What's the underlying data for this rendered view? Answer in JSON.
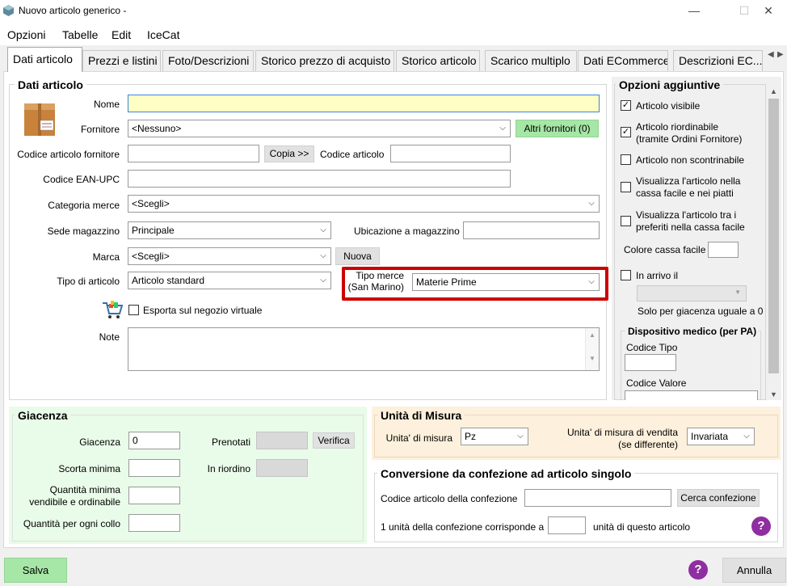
{
  "window": {
    "title": "Nuovo articolo generico -",
    "minimize": "—",
    "maximize": "☐",
    "close": "✕"
  },
  "menu": [
    "Opzioni",
    "Tabelle",
    "Edit",
    "IceCat"
  ],
  "tabs": [
    "Dati articolo",
    "Prezzi e listini",
    "Foto/Descrizioni",
    "Storico prezzo di acquisto",
    "Storico articolo",
    "Scarico multiplo",
    "Dati ECommerce",
    "Descrizioni  EC..."
  ],
  "dati_articolo": {
    "title": "Dati articolo",
    "nome_label": "Nome",
    "nome_value": "",
    "fornitore_label": "Fornitore",
    "fornitore_value": "<Nessuno>",
    "altri_fornitori_btn": "Altri fornitori (0)",
    "codice_fornitore_label": "Codice articolo fornitore",
    "copia_btn": "Copia >>",
    "codice_articolo_label": "Codice articolo",
    "ean_label": "Codice EAN-UPC",
    "categoria_label": "Categoria merce",
    "categoria_value": "<Scegli>",
    "sede_label": "Sede magazzino",
    "sede_value": "Principale",
    "ubicazione_label": "Ubicazione a magazzino",
    "marca_label": "Marca",
    "marca_value": "<Scegli>",
    "nuova_btn": "Nuova",
    "tipo_label": "Tipo di articolo",
    "tipo_value": "Articolo standard",
    "tipo_merce_label_1": "Tipo merce",
    "tipo_merce_label_2": "(San Marino)",
    "tipo_merce_value": "Materie Prime",
    "esporta_label": "Esporta sul negozio virtuale",
    "note_label": "Note"
  },
  "opzioni": {
    "title": "Opzioni aggiuntive",
    "items": [
      {
        "label1": "Articolo visibile",
        "label2": "",
        "checked": "✓"
      },
      {
        "label1": "Articolo riordinabile",
        "label2": "(tramite Ordini Fornitore)",
        "checked": "✓"
      },
      {
        "label1": "Articolo non scontrinabile",
        "label2": "",
        "checked": ""
      },
      {
        "label1": "Visualizza l'articolo nella",
        "label2": "cassa facile e nei piatti",
        "checked": ""
      },
      {
        "label1": "Visualizza l'articolo tra i",
        "label2": "preferiti nella cassa facile",
        "checked": ""
      }
    ],
    "colore_label": "Colore cassa facile",
    "in_arrivo_label": "In arrivo il",
    "solo_giacenza": "Solo per giacenza uguale a 0",
    "dispositivo_title": "Dispositivo medico (per PA)",
    "codice_tipo_label": "Codice Tipo",
    "codice_valore_label": "Codice Valore"
  },
  "giacenza": {
    "title": "Giacenza",
    "giacenza_label": "Giacenza",
    "giacenza_value": "0",
    "prenotati_label": "Prenotati",
    "verifica_btn": "Verifica",
    "scorta_label": "Scorta minima",
    "in_riordino_label": "In riordino",
    "qmin_label_1": "Quantità minima",
    "qmin_label_2": "vendibile e ordinabile",
    "qcollo_label": "Quantità per ogni collo"
  },
  "unita": {
    "title": "Unità di Misura",
    "misura_label": "Unita' di misura",
    "misura_value": "Pz",
    "vendita_label_1": "Unita' di misura di vendita",
    "vendita_label_2": "(se differente)",
    "vendita_value": "Invariata"
  },
  "conversione": {
    "title": "Conversione da confezione ad articolo singolo",
    "codice_label": "Codice articolo della confezione",
    "cerca_btn": "Cerca confezione",
    "unita_label": "1 unità della confezione corrisponde a",
    "unita_suffix": "unità di questo articolo"
  },
  "footer": {
    "salva_btn": "Salva",
    "annulla_btn": "Annulla",
    "help": "?"
  },
  "colors": {
    "highlight": "#cc0000",
    "yellow_field": "#ffffc5",
    "green_btn": "#a6e6a6",
    "help": "#8e2ea0"
  }
}
